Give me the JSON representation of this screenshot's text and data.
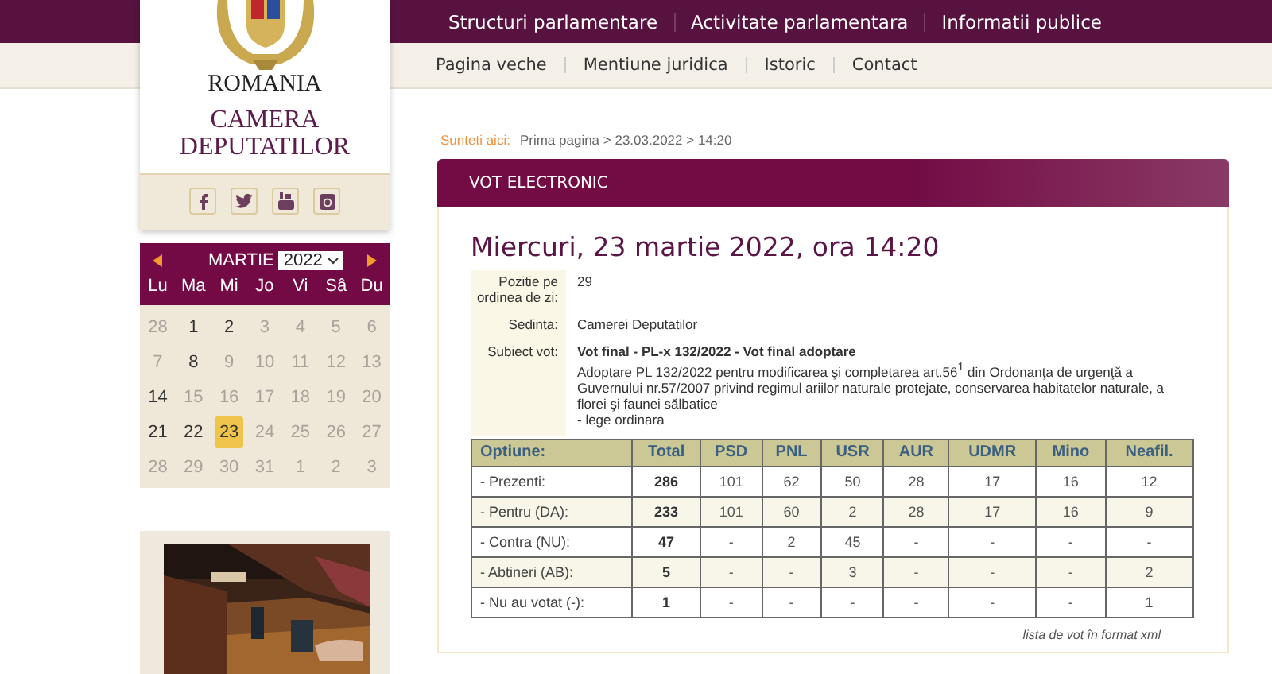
{
  "top_nav": [
    "Structuri parlamentare",
    "Activitate parlamentara",
    "Informatii publice"
  ],
  "sub_nav": [
    "Pagina veche",
    "Mentiune juridica",
    "Istoric",
    "Contact"
  ],
  "logo": {
    "country": "ROMANIA",
    "name": "CAMERA DEPUTATILOR"
  },
  "calendar": {
    "month": "MARTIE",
    "year": "2022",
    "weekdays": [
      "Lu",
      "Ma",
      "Mi",
      "Jo",
      "Vi",
      "Sâ",
      "Du"
    ],
    "days": [
      {
        "label": "28",
        "dim": true,
        "selected": false
      },
      {
        "label": "1",
        "dim": false,
        "selected": false
      },
      {
        "label": "2",
        "dim": false,
        "selected": false
      },
      {
        "label": "3",
        "dim": true,
        "selected": false
      },
      {
        "label": "4",
        "dim": true,
        "selected": false
      },
      {
        "label": "5",
        "dim": true,
        "selected": false
      },
      {
        "label": "6",
        "dim": true,
        "selected": false
      },
      {
        "label": "7",
        "dim": true,
        "selected": false
      },
      {
        "label": "8",
        "dim": false,
        "selected": false
      },
      {
        "label": "9",
        "dim": true,
        "selected": false
      },
      {
        "label": "10",
        "dim": true,
        "selected": false
      },
      {
        "label": "11",
        "dim": true,
        "selected": false
      },
      {
        "label": "12",
        "dim": true,
        "selected": false
      },
      {
        "label": "13",
        "dim": true,
        "selected": false
      },
      {
        "label": "14",
        "dim": false,
        "selected": false
      },
      {
        "label": "15",
        "dim": true,
        "selected": false
      },
      {
        "label": "16",
        "dim": true,
        "selected": false
      },
      {
        "label": "17",
        "dim": true,
        "selected": false
      },
      {
        "label": "18",
        "dim": true,
        "selected": false
      },
      {
        "label": "19",
        "dim": true,
        "selected": false
      },
      {
        "label": "20",
        "dim": true,
        "selected": false
      },
      {
        "label": "21",
        "dim": false,
        "selected": false
      },
      {
        "label": "22",
        "dim": false,
        "selected": false
      },
      {
        "label": "23",
        "dim": false,
        "selected": true
      },
      {
        "label": "24",
        "dim": true,
        "selected": false
      },
      {
        "label": "25",
        "dim": true,
        "selected": false
      },
      {
        "label": "26",
        "dim": true,
        "selected": false
      },
      {
        "label": "27",
        "dim": true,
        "selected": false
      },
      {
        "label": "28",
        "dim": true,
        "selected": false
      },
      {
        "label": "29",
        "dim": true,
        "selected": false
      },
      {
        "label": "30",
        "dim": true,
        "selected": false
      },
      {
        "label": "31",
        "dim": true,
        "selected": false
      },
      {
        "label": "1",
        "dim": true,
        "selected": false
      },
      {
        "label": "2",
        "dim": true,
        "selected": false
      },
      {
        "label": "3",
        "dim": true,
        "selected": false
      }
    ]
  },
  "breadcrumb": {
    "label": "Sunteti aici:",
    "path": "Prima pagina > 23.03.2022 > 14:20"
  },
  "panel": {
    "title": "VOT ELECTRONIC",
    "heading": "Miercuri, 23 martie 2022, ora 14:20",
    "details": [
      {
        "label": "Pozitie pe ordinea de zi:",
        "lines": [
          "29"
        ]
      },
      {
        "label": "Sedinta:",
        "lines": [
          "Camerei Deputatilor"
        ]
      },
      {
        "label": "Subiect vot:",
        "lines": [
          "**Vot final - PL-x 132/2022 - Vot final adoptare**",
          "Adoptare PL 132/2022 pentru modificarea şi completarea art.56$^{1}$ din Ordonanţa de urgenţă a Guvernului nr.57/2007 privind regimul ariilor naturale protejate, conservarea habitatelor naturale, a florei şi faunei sălbatice",
          "- lege ordinara"
        ]
      }
    ],
    "table": {
      "columns": [
        "Optiune:",
        "Total",
        "PSD",
        "PNL",
        "USR",
        "AUR",
        "UDMR",
        "Mino",
        "Neafil."
      ],
      "rows": [
        [
          "- Prezenti:",
          "286",
          "101",
          "62",
          "50",
          "28",
          "17",
          "16",
          "12"
        ],
        [
          "- Pentru (DA):",
          "233",
          "101",
          "60",
          "2",
          "28",
          "17",
          "16",
          "9"
        ],
        [
          "- Contra (NU):",
          "47",
          "-",
          "2",
          "45",
          "-",
          "-",
          "-",
          "-"
        ],
        [
          "- Abtineri (AB):",
          "5",
          "-",
          "-",
          "3",
          "-",
          "-",
          "-",
          "2"
        ],
        [
          "- Nu au votat (-):",
          "1",
          "-",
          "-",
          "-",
          "-",
          "-",
          "-",
          "1"
        ]
      ]
    },
    "xml_link": "lista de vot în format xml"
  }
}
